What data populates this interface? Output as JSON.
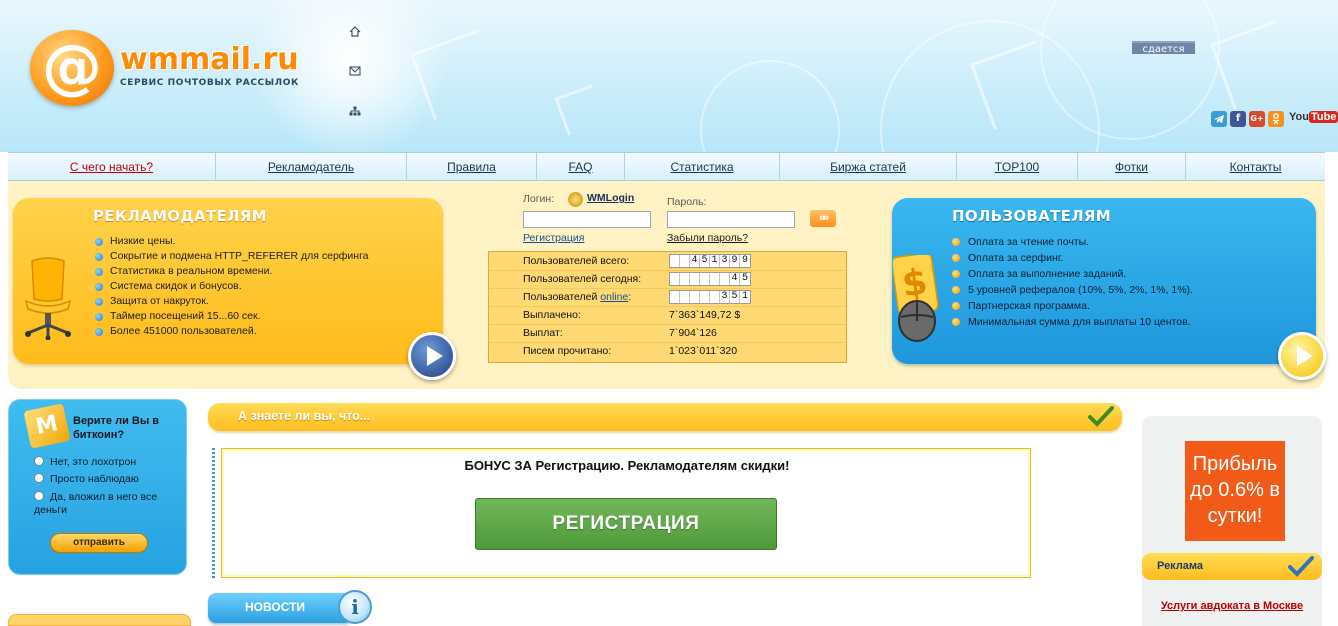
{
  "header": {
    "logo_name": "wmmail.ru",
    "logo_tagline": "СЕРВИС ПОЧТОВЫХ РАССЫЛОК",
    "rent_badge": "сдается",
    "icons": [
      "home-icon",
      "mail-icon",
      "sitemap-icon"
    ],
    "social": [
      "telegram-icon",
      "facebook-icon",
      "google-plus-icon",
      "odnoklassniki-icon",
      "youtube-icon"
    ],
    "youtube_you": "You",
    "youtube_tube": "Tube"
  },
  "nav": {
    "items": [
      {
        "label": "С чего начать?"
      },
      {
        "label": "Рекламодатель"
      },
      {
        "label": "Правила"
      },
      {
        "label": "FAQ"
      },
      {
        "label": "Статистика"
      },
      {
        "label": "Биржа статей"
      },
      {
        "label": "TOP100"
      },
      {
        "label": "Фотки"
      },
      {
        "label": "Контакты"
      }
    ]
  },
  "advertisers": {
    "title": "РЕКЛАМОДАТЕЛЯМ",
    "items": [
      "Низкие цены.",
      "Сокрытие и подмена HTTP_REFERER для серфинга",
      "Статистика в реальном времени.",
      "Система скидок и бонусов.",
      "Защита от накруток.",
      "Таймер посещений 15...60 сек.",
      "Более 451000 пользователей."
    ]
  },
  "users": {
    "title": "ПОЛЬЗОВАТЕЛЯМ",
    "items": [
      "Оплата за чтение почты.",
      "Оплата за серфинг.",
      "Оплата за выполнение заданий.",
      "5 уровней рефералов (10%, 5%, 2%, 1%, 1%).",
      "Партнерская программа.",
      "Минимальная сумма для выплаты 10 центов."
    ]
  },
  "login": {
    "login_label": "Логин:",
    "wmlogin": "WMLogin",
    "password_label": "Пароль:",
    "register_link": "Регистрация",
    "forgot_link": "Забыли пароль?",
    "go_label": "»»",
    "login_value": "",
    "password_value": ""
  },
  "stats": {
    "total_label": "Пользователей всего:",
    "total_digits": [
      "",
      "",
      "4",
      "5",
      "1",
      "3",
      "9",
      "9"
    ],
    "today_label": "Пользователей сегодня:",
    "today_digits": [
      "",
      "",
      "",
      "",
      "",
      "",
      "4",
      "5"
    ],
    "online_prefix": "Пользователей ",
    "online_link": "online",
    "online_suffix": ":",
    "online_digits": [
      "",
      "",
      "",
      "",
      "",
      "3",
      "5",
      "1"
    ],
    "paid_label": "Выплачено:",
    "paid_value": "7`363`149,72 $",
    "payouts_label": "Выплат:",
    "payouts_value": "7`904`126",
    "read_label": "Писем прочитано:",
    "read_value": "1`023`011`320"
  },
  "poll": {
    "question": "Верите ли Вы в биткоин?",
    "options": [
      "Нет, это лохотрон",
      "Просто наблюдаю",
      "Да, вложил в него все деньги"
    ],
    "submit": "отправить"
  },
  "center": {
    "did_you_know": "А знаете ли вы, что...",
    "bonus_text": "БОНУС ЗА Регистрацию. Рекламодателям скидки!",
    "register_button": "РЕГИСТРАЦИЯ",
    "news_title": "НОВОСТИ",
    "news_info_icon": "i"
  },
  "right": {
    "profit_text": "Прибыль до 0.6% в сутки!",
    "ad_title": "Реклама",
    "lawyer_link": "Услуги авдоката в Москве"
  },
  "colors": {
    "accent_orange": "#ffbd1f",
    "accent_blue": "#2aa0e0",
    "nav_active": "#c40000",
    "register_green": "#4e9a3b",
    "profit_orange": "#f25a18"
  }
}
